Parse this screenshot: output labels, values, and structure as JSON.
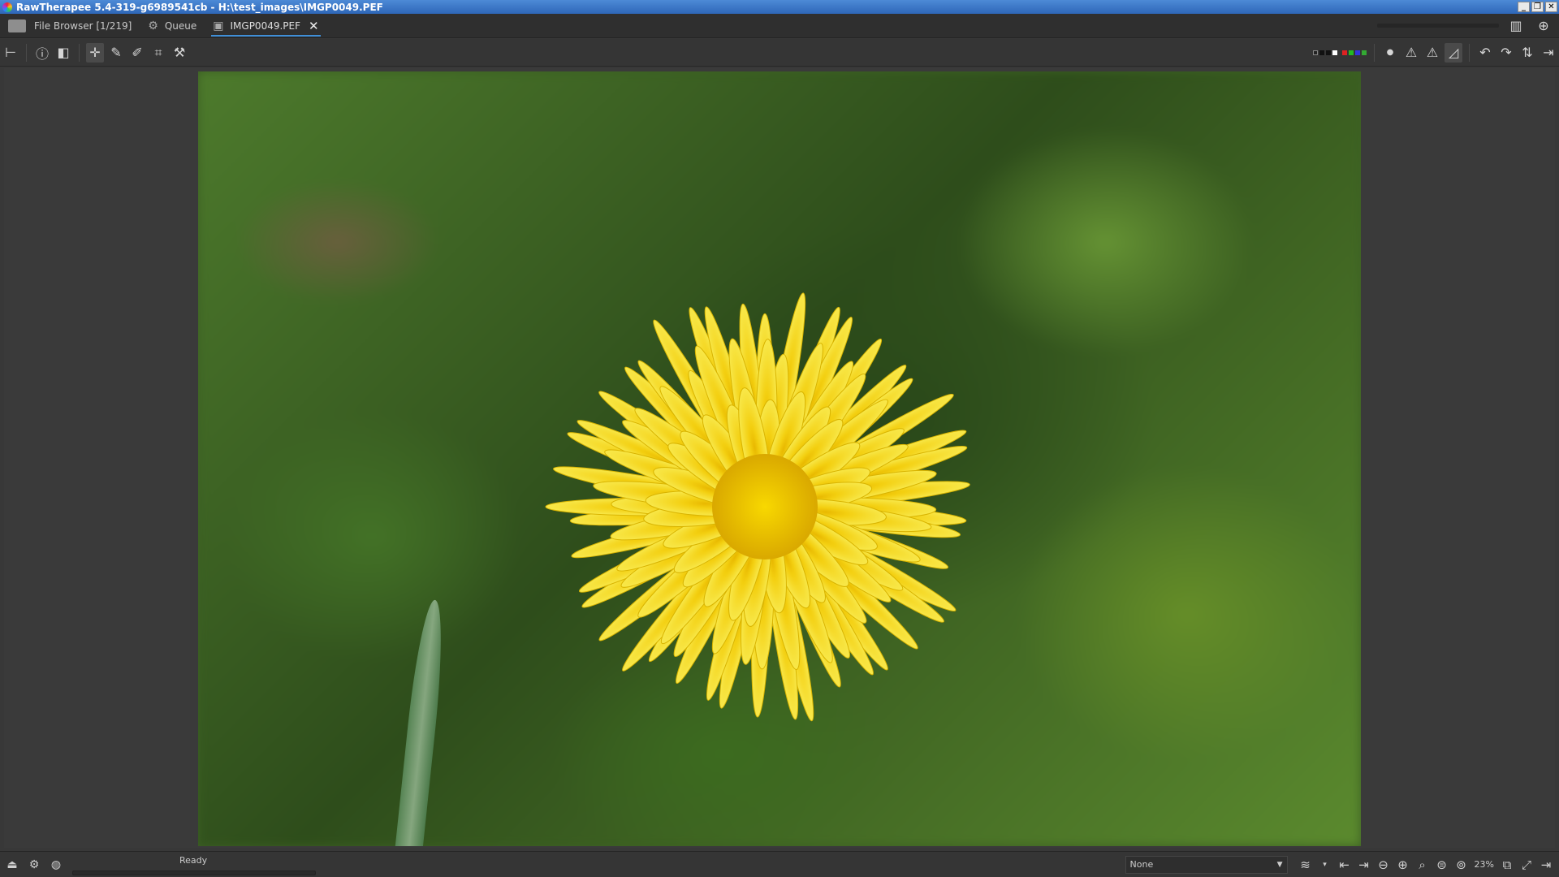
{
  "window": {
    "title": "RawTherapee 5.4-319-g6989541cb - H:\\test_images\\IMGP0049.PEF"
  },
  "tabs": [
    {
      "label": "File Browser [1/219]"
    },
    {
      "label": "Queue"
    },
    {
      "label": "IMGP0049.PEF"
    }
  ],
  "toolbar": {
    "icons": [
      "hide-history-icon",
      "info-icon",
      "before-after-icon",
      "hand-tool-icon",
      "white-balance-picker-icon",
      "color-picker-icon",
      "crop-icon",
      "straighten-icon"
    ],
    "right_icons": [
      "preview-mode-icon",
      "clip-indicator-icon",
      "highlight-warning-icon",
      "shadow-warning-icon",
      "histogram-icon",
      "rotate-left-icon",
      "rotate-right-icon",
      "flip-horizontal-icon",
      "flip-vertical-icon"
    ]
  },
  "colors": {
    "accent": "#3f8fd8",
    "flower": "#f5d80f",
    "flower_center": "#e8b800"
  },
  "status": {
    "text": "Ready",
    "progress": 0
  },
  "bottom_right": {
    "profile_value": "None",
    "zoom": "23%"
  }
}
